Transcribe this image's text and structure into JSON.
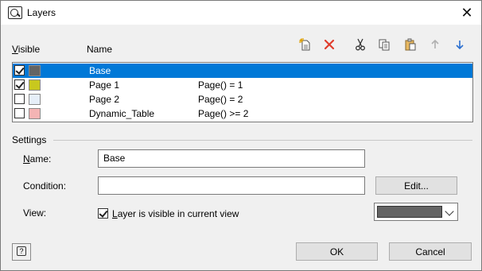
{
  "window": {
    "title": "Layers",
    "app_icon": "layers-app-icon",
    "close_glyph": "✕"
  },
  "columns": {
    "visible": "Visible",
    "name": "Name"
  },
  "toolbar": {
    "new_icon": "new-layer-icon",
    "delete_icon": "delete-icon",
    "cut_icon": "cut-icon",
    "copy_icon": "copy-icon",
    "paste_icon": "paste-icon",
    "up_icon": "arrow-up-icon",
    "down_icon": "arrow-down-icon"
  },
  "layers": [
    {
      "name": "Base",
      "condition": "",
      "visible": true,
      "color": "#646464",
      "selected": true
    },
    {
      "name": "Page 1",
      "condition": "Page() = 1",
      "visible": true,
      "color": "#c8c81e",
      "selected": false
    },
    {
      "name": "Page 2",
      "condition": "Page() = 2",
      "visible": false,
      "color": "#e6eef8",
      "selected": false
    },
    {
      "name": "Dynamic_Table",
      "condition": "Page() >= 2",
      "visible": false,
      "color": "#f4b4b4",
      "selected": false
    }
  ],
  "settings": {
    "section_label": "Settings",
    "name_label": "Name:",
    "name_value": "Base",
    "condition_label": "Condition:",
    "condition_value": "",
    "edit_button": "Edit...",
    "view_label": "View:",
    "visible_checkbox_label": "Layer is visible in current view",
    "visible_checked": true,
    "color_value": "#646464"
  },
  "footer": {
    "help_icon": "help-icon",
    "ok_button": "OK",
    "cancel_button": "Cancel"
  },
  "colors": {
    "selection": "#0078d7",
    "delete": "#e03c2c",
    "arrow_up": "#b0b0b0",
    "arrow_down": "#2a6fd0"
  }
}
